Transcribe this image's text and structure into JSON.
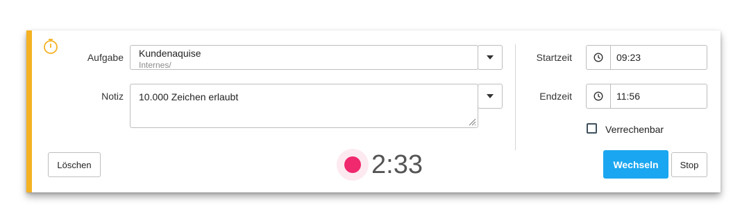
{
  "task": {
    "label": "Aufgabe",
    "title": "Kundenaquise",
    "subtitle": "Internes/"
  },
  "note": {
    "label": "Notiz",
    "value": "10.000 Zeichen erlaubt"
  },
  "start": {
    "label": "Startzeit",
    "value": "09:23"
  },
  "end": {
    "label": "Endzeit",
    "value": "11:56"
  },
  "billable": {
    "label": "Verrechenbar",
    "checked": false
  },
  "buttons": {
    "delete": "Löschen",
    "switch": "Wechseln",
    "stop": "Stop"
  },
  "timer": {
    "elapsed": "2:33"
  },
  "colors": {
    "accent_bar": "#f4b223",
    "primary_button": "#1aa6f0",
    "record_dot": "#f0286e"
  },
  "icons": {
    "header": "stopwatch-icon",
    "time": "clock-icon",
    "dropdown": "chevron-down-icon",
    "record": "record-icon"
  }
}
